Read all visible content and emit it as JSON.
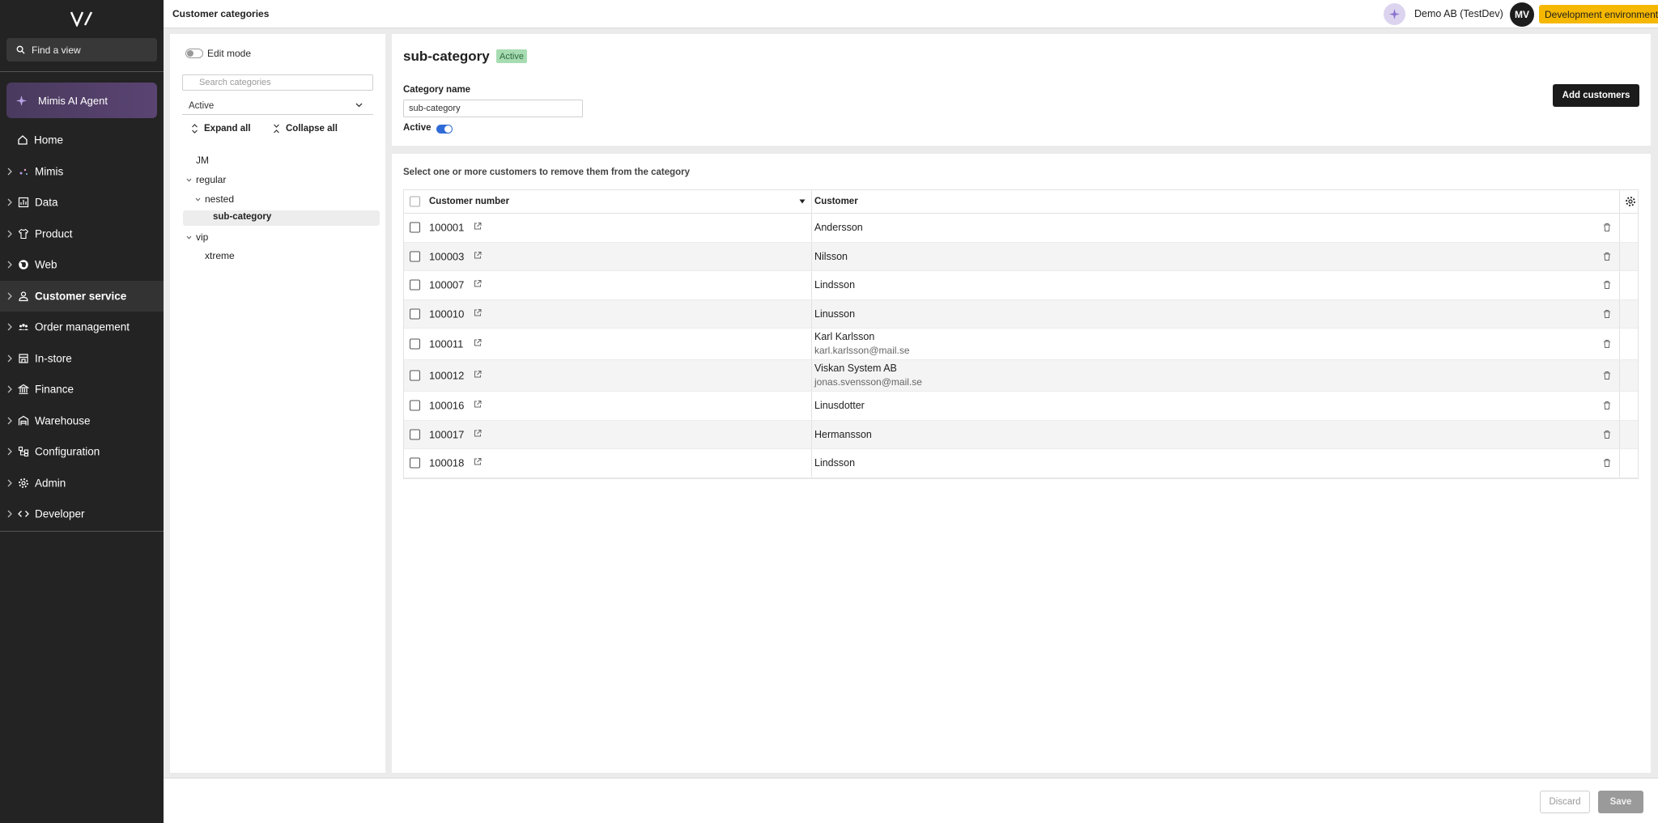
{
  "sidebar": {
    "find_view": "Find a view",
    "ai_agent": "Mimis AI Agent",
    "items": [
      {
        "label": "Home",
        "icon": "home-icon"
      },
      {
        "label": "Mimis",
        "icon": "sparkle-icon"
      },
      {
        "label": "Data",
        "icon": "chart-icon"
      },
      {
        "label": "Product",
        "icon": "shirt-icon"
      },
      {
        "label": "Web",
        "icon": "globe-icon"
      },
      {
        "label": "Customer service",
        "icon": "user-icon",
        "active": true
      },
      {
        "label": "Order management",
        "icon": "people-icon"
      },
      {
        "label": "In-store",
        "icon": "store-icon"
      },
      {
        "label": "Finance",
        "icon": "bank-icon"
      },
      {
        "label": "Warehouse",
        "icon": "warehouse-icon"
      },
      {
        "label": "Configuration",
        "icon": "nodes-icon"
      },
      {
        "label": "Admin",
        "icon": "gear-icon"
      },
      {
        "label": "Developer",
        "icon": "code-icon"
      }
    ]
  },
  "header": {
    "title": "Customer categories",
    "company": "Demo AB (TestDev)",
    "avatar_initials": "MV",
    "environment": "Development environment"
  },
  "tree": {
    "edit_mode": "Edit mode",
    "search_placeholder": "Search categories",
    "status_filter": "Active",
    "expand_all": "Expand all",
    "collapse_all": "Collapse all",
    "nodes": {
      "jm": "JM",
      "regular": "regular",
      "nested": "nested",
      "sub_category": "sub-category",
      "vip": "vip",
      "xtreme": "xtreme"
    }
  },
  "detail": {
    "title": "sub-category",
    "badge": "Active",
    "name_label": "Category name",
    "name_value": "sub-category",
    "active_label": "Active",
    "add_customers": "Add customers"
  },
  "table": {
    "hint": "Select one or more customers to remove them from the category",
    "col_number": "Customer number",
    "col_customer": "Customer",
    "rows": [
      {
        "number": "100001",
        "name": "Andersson"
      },
      {
        "number": "100003",
        "name": "Nilsson"
      },
      {
        "number": "100007",
        "name": "Lindsson"
      },
      {
        "number": "100010",
        "name": "Linusson"
      },
      {
        "number": "100011",
        "name": "Karl Karlsson",
        "email": "karl.karlsson@mail.se"
      },
      {
        "number": "100012",
        "name": "Viskan System AB",
        "email": "jonas.svensson@mail.se"
      },
      {
        "number": "100016",
        "name": "Linusdotter"
      },
      {
        "number": "100017",
        "name": "Hermansson"
      },
      {
        "number": "100018",
        "name": "Lindsson"
      }
    ]
  },
  "footer": {
    "discard": "Discard",
    "save": "Save"
  },
  "colors": {
    "sidebar_bg": "#232323",
    "accent_toggle": "#2f6bd6",
    "env_badge": "#f5b700",
    "active_badge_bg": "#a7dcb2"
  }
}
